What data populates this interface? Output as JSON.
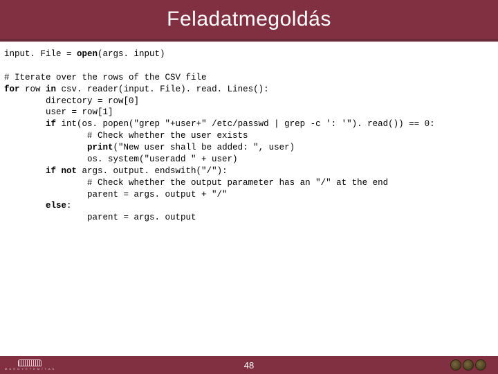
{
  "header": {
    "title": "Feladatmegoldás"
  },
  "code": {
    "l01a": "input. File = ",
    "l01b": "open",
    "l01c": "(args. input)",
    "l02": "",
    "l03a": "# Iterate over the rows of the CSV file",
    "l04a": "for",
    "l04b": " row ",
    "l04c": "in",
    "l04d": " csv. reader(input. File). read. Lines():",
    "l05": "        directory = row[0]",
    "l06": "        user = row[1]",
    "l07a": "        ",
    "l07b": "if",
    "l07c": " int(os. popen(\"grep \"+user+\" /etc/passwd | grep -c ': '\"). read()) == 0:",
    "l08": "                # Check whether the user exists",
    "l09a": "                ",
    "l09b": "print",
    "l09c": "(\"New user shall be added: \", user)",
    "l10": "                os. system(\"useradd \" + user)",
    "l11a": "        ",
    "l11b": "if not",
    "l11c": " args. output. endswith(\"/\"):",
    "l12": "                # Check whether the output parameter has an \"/\" at the end",
    "l13": "                parent = args. output + \"/\"",
    "l14a": "        ",
    "l14b": "else",
    "l14c": ":",
    "l15": "                parent = args. output"
  },
  "footer": {
    "logo_text": "M U E G Y E T E M  I T A S",
    "page_number": "48"
  }
}
